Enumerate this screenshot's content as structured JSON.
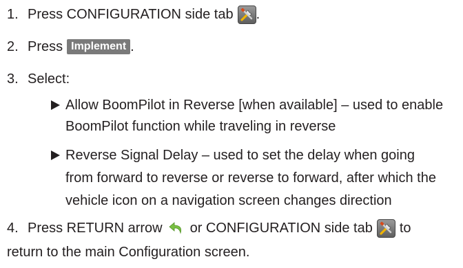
{
  "steps": [
    {
      "number": "1.",
      "text": "Press CONFIGURATION side tab",
      "after": ".",
      "icon": "tools-icon"
    },
    {
      "number": "2.",
      "text": "Press",
      "button_label": "Implement",
      "after": "."
    },
    {
      "number": "3.",
      "text": "Select:",
      "bullets": [
        {
          "lines": [
            "Allow BoomPilot in Reverse [when available] – used to enable",
            "BoomPilot function while traveling in reverse"
          ]
        },
        {
          "lines": [
            "Reverse Signal Delay – used to set the delay when going",
            "from forward to reverse or reverse to forward, after which the",
            "vehicle icon on a navigation screen changes direction"
          ]
        }
      ]
    },
    {
      "number": "4.",
      "text_a": "Press RETURN arrow",
      "text_b": "or CONFIGURATION side tab",
      "text_c": "to",
      "line2": "return to the main Configuration screen.",
      "icons": [
        "return-arrow-icon",
        "tools-icon"
      ]
    }
  ],
  "colors": {
    "text": "#231f20",
    "button_bg": "#7a7a7a",
    "button_text": "#ffffff",
    "arrow_green": "#7ac143",
    "tool_bg": "#6b6b6b"
  }
}
